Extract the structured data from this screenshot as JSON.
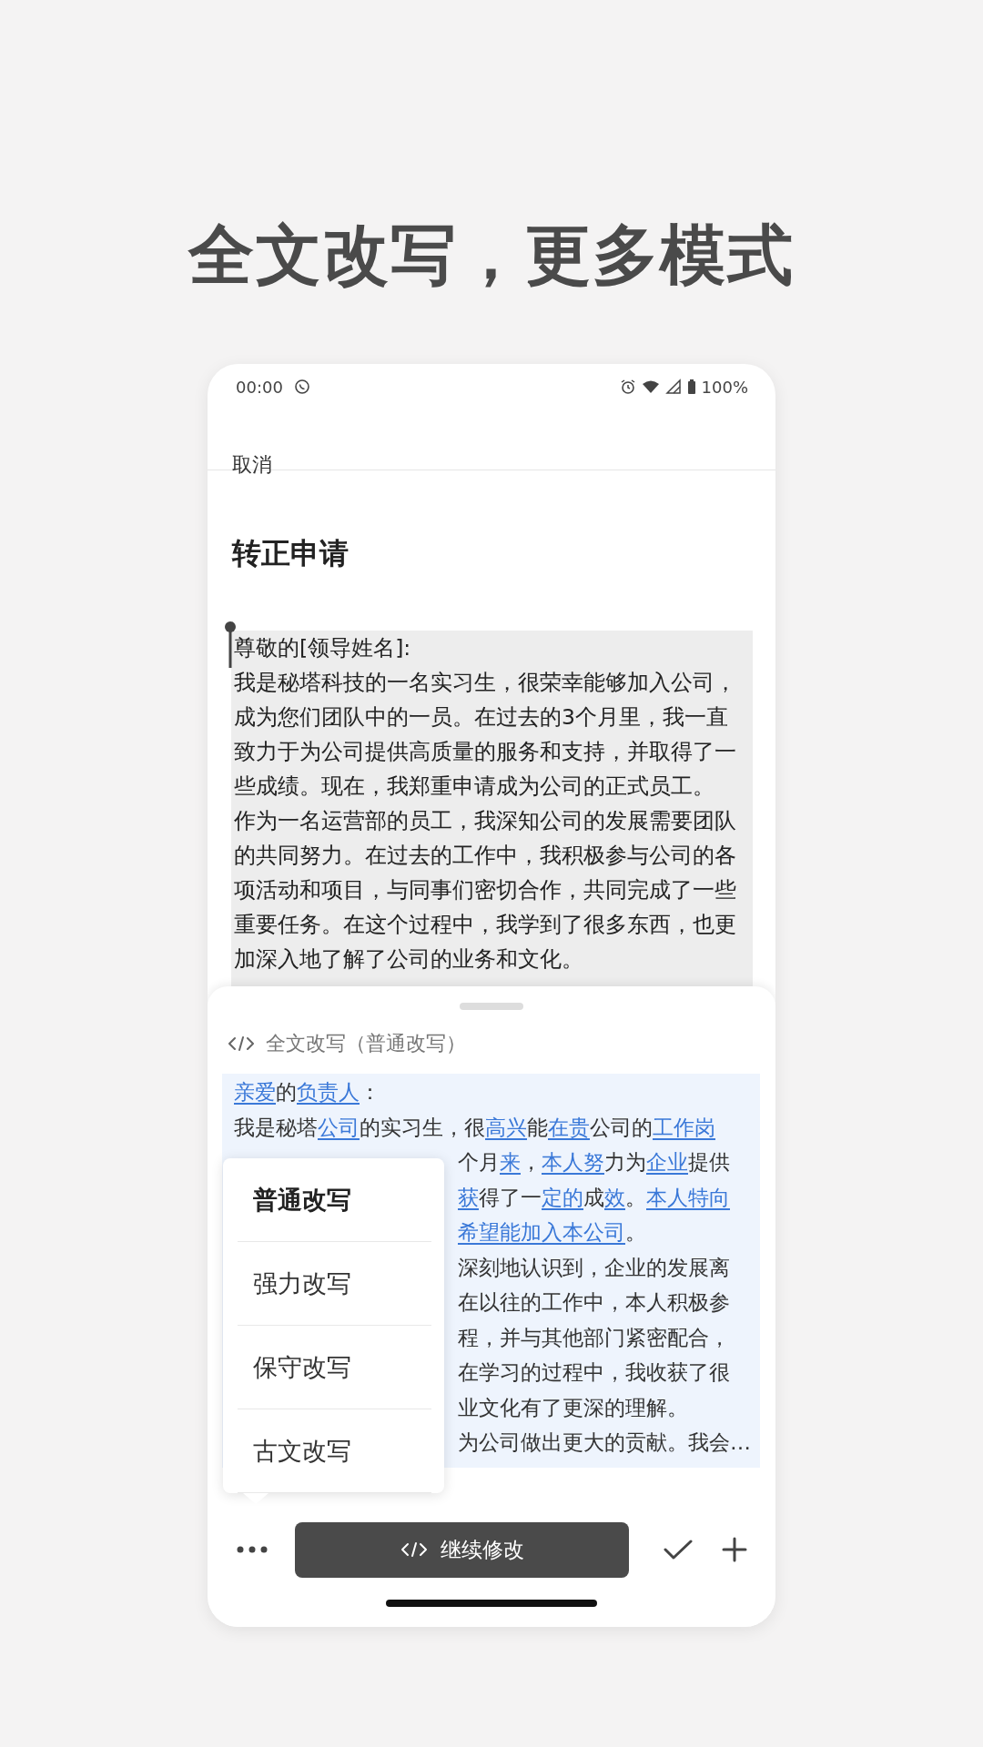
{
  "headline": "全文改写，更多模式",
  "status_bar": {
    "time": "00:00",
    "battery": "100%"
  },
  "header": {
    "cancel": "取消"
  },
  "document": {
    "title": "转正申请",
    "lines": [
      "尊敬的[领导姓名]:",
      "我是秘塔科技的一名实习生，很荣幸能够加入公司，",
      "成为您们团队中的一员。在过去的3个月里，我一直",
      "致力于为公司提供高质量的服务和支持，并取得了一",
      "些成绩。现在，我郑重申请成为公司的正式员工。",
      "作为一名运营部的员工，我深知公司的发展需要团队",
      "的共同努力。在过去的工作中，我积极参与公司的各",
      "项活动和项目，与同事们密切合作，共同完成了一些",
      "重要任务。在这个过程中，我学到了很多东西，也更",
      "加深入地了解了公司的业务和文化。"
    ]
  },
  "rewrite_sheet": {
    "header": "全文改写（普通改写）",
    "lines": [
      {
        "kind": "full",
        "segments": [
          {
            "text": "亲爱",
            "changed": true
          },
          {
            "text": "的",
            "changed": false
          },
          {
            "text": "负责人",
            "changed": true
          },
          {
            "text": "：",
            "changed": false
          }
        ]
      },
      {
        "kind": "full",
        "segments": [
          {
            "text": "我是秘塔",
            "changed": false
          },
          {
            "text": "公司",
            "changed": true
          },
          {
            "text": "的实习生，很",
            "changed": false
          },
          {
            "text": "高兴",
            "changed": true
          },
          {
            "text": "能",
            "changed": false
          },
          {
            "text": "在贵",
            "changed": true
          },
          {
            "text": "公司的",
            "changed": false
          },
          {
            "text": "工作岗",
            "changed": true
          }
        ]
      },
      {
        "kind": "partial",
        "segments": [
          {
            "text": "个月",
            "changed": false
          },
          {
            "text": "来",
            "changed": true
          },
          {
            "text": "，",
            "changed": false
          },
          {
            "text": "本人努",
            "changed": true
          },
          {
            "text": "力为",
            "changed": false
          },
          {
            "text": "企业",
            "changed": true
          },
          {
            "text": "提供",
            "changed": false
          }
        ]
      },
      {
        "kind": "partial",
        "segments": [
          {
            "text": "获",
            "changed": true
          },
          {
            "text": "得了一",
            "changed": false
          },
          {
            "text": "定的",
            "changed": true
          },
          {
            "text": "成",
            "changed": false
          },
          {
            "text": "效",
            "changed": true
          },
          {
            "text": "。",
            "changed": false
          },
          {
            "text": "本人特向",
            "changed": true
          }
        ]
      },
      {
        "kind": "partial",
        "segments": [
          {
            "text": "希望能加入本公司",
            "changed": true
          },
          {
            "text": "。",
            "changed": false
          }
        ]
      },
      {
        "kind": "partial",
        "segments": [
          {
            "text": "深刻地认识到，企业的发展离",
            "changed": false
          }
        ]
      },
      {
        "kind": "partial",
        "segments": [
          {
            "text": "在以往的工作中，本人积极参",
            "changed": false
          }
        ]
      },
      {
        "kind": "partial",
        "segments": [
          {
            "text": "程，并与其他部门紧密配合，",
            "changed": false
          }
        ]
      },
      {
        "kind": "partial",
        "segments": [
          {
            "text": "在学习的过程中，我收获了很",
            "changed": false
          }
        ]
      },
      {
        "kind": "partial",
        "segments": [
          {
            "text": "业文化有了更深的理解。",
            "changed": false
          }
        ]
      },
      {
        "kind": "partial",
        "segments": [
          {
            "text": "为公司做出更大的贡献。我会…",
            "changed": false
          }
        ]
      }
    ]
  },
  "mode_menu": [
    {
      "label": "普通改写",
      "selected": true
    },
    {
      "label": "强力改写",
      "selected": false
    },
    {
      "label": "保守改写",
      "selected": false
    },
    {
      "label": "古文改写",
      "selected": false
    }
  ],
  "actions": {
    "continue": "继续修改"
  }
}
